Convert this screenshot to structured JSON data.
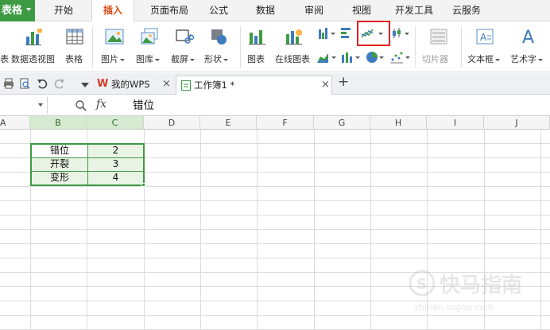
{
  "menubar": {
    "app_label": "表格",
    "tabs": [
      {
        "label": "开始"
      },
      {
        "label": "插入"
      },
      {
        "label": "页面布局"
      },
      {
        "label": "公式"
      },
      {
        "label": "数据"
      },
      {
        "label": "审阅"
      },
      {
        "label": "视图"
      },
      {
        "label": "开发工具"
      },
      {
        "label": "云服务"
      }
    ],
    "active_tab": "插入"
  },
  "ribbon": {
    "truncated_left_label": "表",
    "pivot_label": "数据透视图",
    "table_label": "表格",
    "picture_label": "图片",
    "gallery_label": "图库",
    "screenshot_label": "截屏",
    "shape_label": "形状",
    "chart_label": "图表",
    "online_chart_label": "在线图表",
    "slicer_label": "切片器",
    "textbox_label": "文本框",
    "wordart_label": "艺术字",
    "highlighted_button": "line-chart-button"
  },
  "tabstrip": {
    "wps_tab_label": "我的WPS",
    "workbook_tab_label": "工作簿1 *",
    "close_glyph": "×",
    "new_tab_glyph": "+",
    "wps_logo_glyph": "W"
  },
  "formula_bar": {
    "fx_label": "fx",
    "value": "错位"
  },
  "sheet": {
    "columns": [
      "A",
      "B",
      "C",
      "D",
      "E",
      "F",
      "G",
      "H",
      "I",
      "J"
    ],
    "selected_columns": [
      "B",
      "C"
    ],
    "cells": {
      "B1": "错位",
      "C1": "2",
      "B2": "开裂",
      "C2": "3",
      "B3": "变形",
      "C3": "4"
    }
  },
  "watermark": {
    "cn_text": "快马指南",
    "en_text": "zhinan.sogou.com"
  },
  "colors": {
    "accent_green": "#3e9b43",
    "active_tab_text": "#d9480f",
    "highlight_red": "#e02020"
  }
}
